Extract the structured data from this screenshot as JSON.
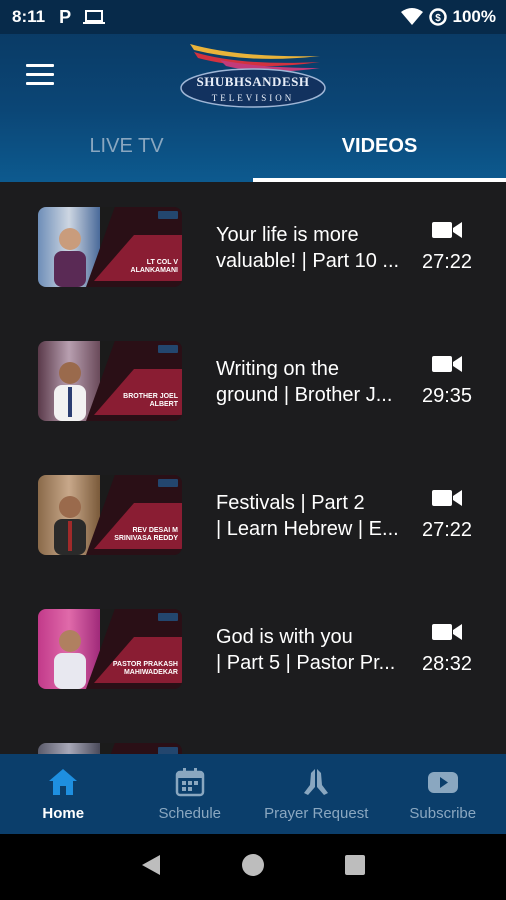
{
  "status_bar": {
    "time": "8:11",
    "battery": "100%",
    "icons": [
      "parking-icon",
      "laptop-icon",
      "wifi-icon",
      "data-saver-icon"
    ]
  },
  "app_bar": {
    "menu_icon": "hamburger-menu-icon",
    "logo_text": "SHUBHSANDESH",
    "logo_subtext": "TELEVISION"
  },
  "tabs": [
    {
      "label": "LIVE TV",
      "active": false
    },
    {
      "label": "VIDEOS",
      "active": true
    }
  ],
  "videos": [
    {
      "title_line1": "Your life is more",
      "title_line2": "valuable! | Part 10 ...",
      "duration": "27:22",
      "speaker": "LT COL V ALANKAMANI"
    },
    {
      "title_line1": "Writing on the",
      "title_line2": "ground | Brother J...",
      "duration": "29:35",
      "speaker": "BROTHER JOEL ALBERT"
    },
    {
      "title_line1": "Festivals | Part 2",
      "title_line2": "| Learn Hebrew | E...",
      "duration": "27:22",
      "speaker": "REV DESAI M SRINIVASA REDDY"
    },
    {
      "title_line1": "God is with you",
      "title_line2": "| Part 5 | Pastor Pr...",
      "duration": "28:32",
      "speaker": "PASTOR PRAKASH MAHIWADEKAR"
    },
    {
      "title_line1": "",
      "title_line2": "",
      "duration": "",
      "speaker": ""
    }
  ],
  "bottom_nav": [
    {
      "label": "Home",
      "icon": "home-icon",
      "active": true
    },
    {
      "label": "Schedule",
      "icon": "calendar-icon",
      "active": false
    },
    {
      "label": "Prayer Request",
      "icon": "praying-hands-icon",
      "active": false
    },
    {
      "label": "Subscribe",
      "icon": "youtube-icon",
      "active": false
    }
  ],
  "colors": {
    "app_bar": "#0a3b66",
    "background": "#1c1c1e",
    "thumb_accent": "#8a1d33",
    "inactive": "#8aa7c0"
  }
}
